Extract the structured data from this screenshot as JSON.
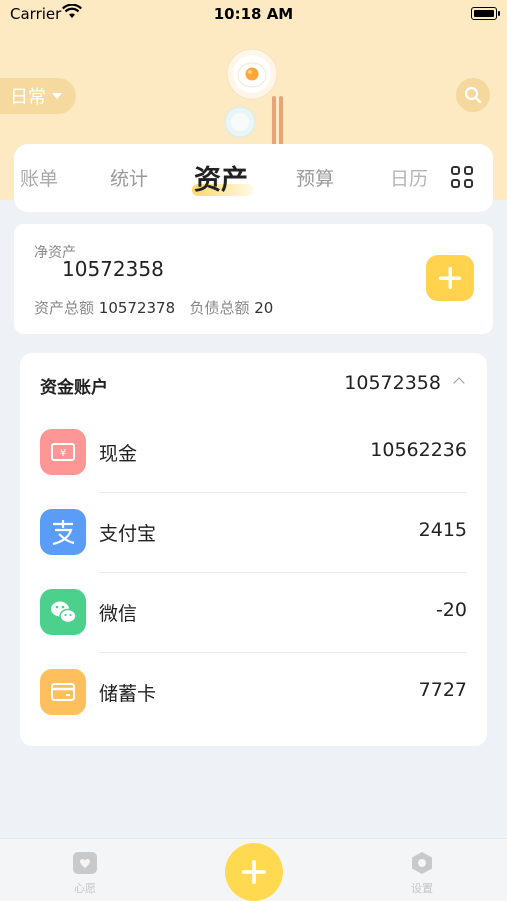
{
  "status_bar": {
    "carrier": "Carrier",
    "time": "10:18 AM"
  },
  "header": {
    "book_selector": "日常"
  },
  "tabs": [
    {
      "label": "账单"
    },
    {
      "label": "统计"
    },
    {
      "label": "资产"
    },
    {
      "label": "预算"
    },
    {
      "label": "日历"
    }
  ],
  "active_tab": "资产",
  "net_assets": {
    "label": "净资产",
    "value": "10572358",
    "total_assets_label": "资产总额",
    "total_assets_value": "10572378",
    "total_liabilities_label": "负债总额",
    "total_liabilities_value": "20"
  },
  "accounts": {
    "title": "资金账户",
    "total": "10572358",
    "items": [
      {
        "name": "现金",
        "amount": "10562236",
        "icon": "cash-icon",
        "color": "#ff8e8e"
      },
      {
        "name": "支付宝",
        "amount": "2415",
        "icon": "alipay-icon",
        "color": "#5b9cf6"
      },
      {
        "name": "微信",
        "amount": "-20",
        "icon": "wechat-icon",
        "color": "#4cd18c"
      },
      {
        "name": "储蓄卡",
        "amount": "7727",
        "icon": "card-icon",
        "color": "#ffbf5c"
      }
    ]
  },
  "bottom_tabs": {
    "wish_label": "心愿",
    "settings_label": "设置"
  },
  "colors": {
    "accent": "#ffd34d",
    "header_bg": "#fde9c2",
    "page_bg": "#eef1f5"
  }
}
